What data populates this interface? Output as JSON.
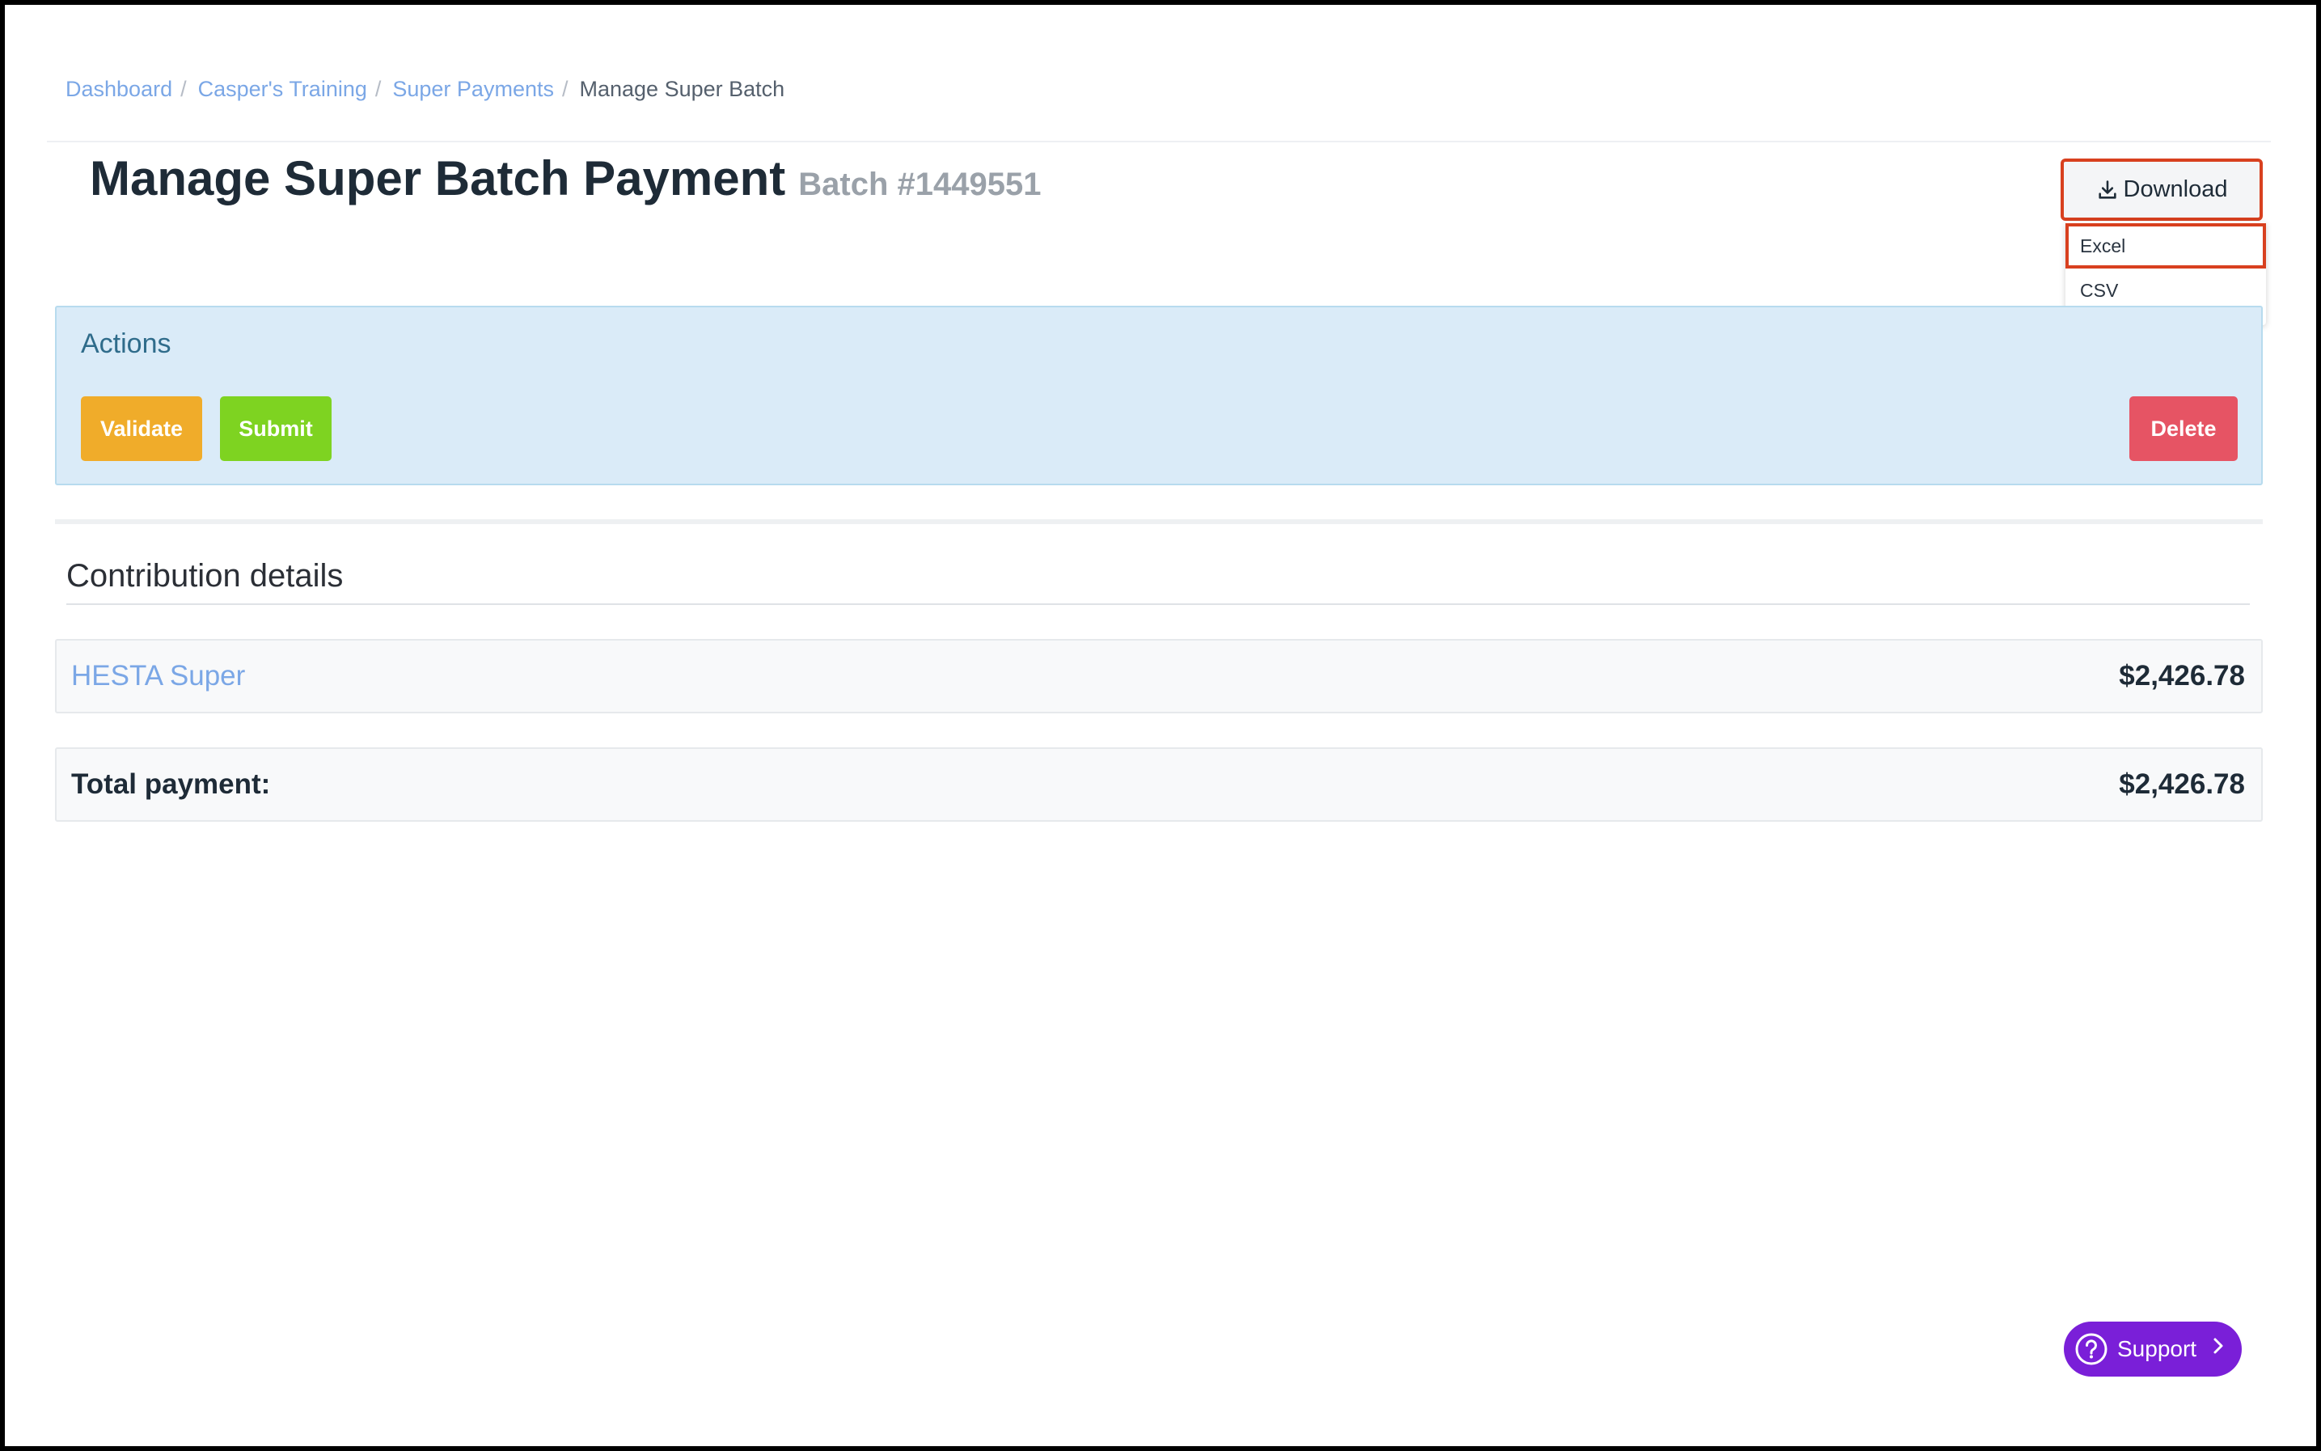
{
  "breadcrumb": {
    "items": [
      {
        "label": "Dashboard"
      },
      {
        "label": "Casper's Training"
      },
      {
        "label": "Super Payments"
      }
    ],
    "separator": "/",
    "current": "Manage Super Batch"
  },
  "header": {
    "title": "Manage Super Batch Payment",
    "batch": "Batch #1449551"
  },
  "download": {
    "label": "Download",
    "icon": "download-icon",
    "options": [
      "Excel",
      "CSV"
    ],
    "highlight_color": "#d8401f"
  },
  "actions": {
    "title": "Actions",
    "validate_label": "Validate",
    "submit_label": "Submit",
    "delete_label": "Delete",
    "colors": {
      "validate": "#f0ac2a",
      "submit": "#7ed321",
      "delete": "#e65464",
      "panel": "#daebf8"
    }
  },
  "contributions": {
    "title": "Contribution details",
    "rows": [
      {
        "fund": "HESTA Super",
        "amount": "$2,426.78"
      }
    ],
    "total_label": "Total payment:",
    "total_amount": "$2,426.78"
  },
  "support": {
    "label": "Support",
    "icon": "question-circle-icon",
    "color": "#7a1fd8"
  }
}
